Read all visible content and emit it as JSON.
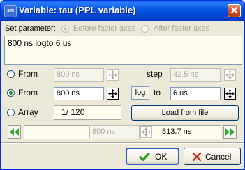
{
  "window": {
    "title": "Variable: tau (PPL variable)",
    "app_icon_text": "sm",
    "close_symbol": "✕"
  },
  "set_parameter": {
    "label": "Set parameter:",
    "options": [
      {
        "label": "Before faster axes",
        "selected": true,
        "enabled": false
      },
      {
        "label": "After faster axes",
        "selected": false,
        "enabled": false
      }
    ]
  },
  "expression": "800 ns logto 6 us",
  "rows": {
    "from_step": {
      "radio_label": "From",
      "selected": false,
      "from_value": "800 ns",
      "step_label": "step",
      "step_value": "42.5 ns"
    },
    "from_to": {
      "radio_label": "From",
      "selected": true,
      "from_value": "800 ns",
      "log_label": "log",
      "to_label": "to",
      "to_value": "6 us"
    },
    "array": {
      "radio_label": "Array",
      "selected": false,
      "index_value": "1/ 120",
      "load_button": "Load from file"
    }
  },
  "navigator": {
    "current_value": "800 ns",
    "computed_value": "813.7 ns"
  },
  "buttons": {
    "ok": "OK",
    "cancel": "Cancel"
  },
  "colors": {
    "titlebar": "#0454e3",
    "nav_arrow_green": "#2fa82f",
    "ok_check_green": "#1f9a1f",
    "cancel_x_red": "#c8351c",
    "textarea_bg": "#fffeee"
  },
  "icons": {
    "spin": "spin-cross-arrows-icon",
    "nav_left": "double-chevron-left-icon",
    "nav_right": "double-chevron-right-icon",
    "ok": "check-icon",
    "cancel": "x-icon"
  }
}
